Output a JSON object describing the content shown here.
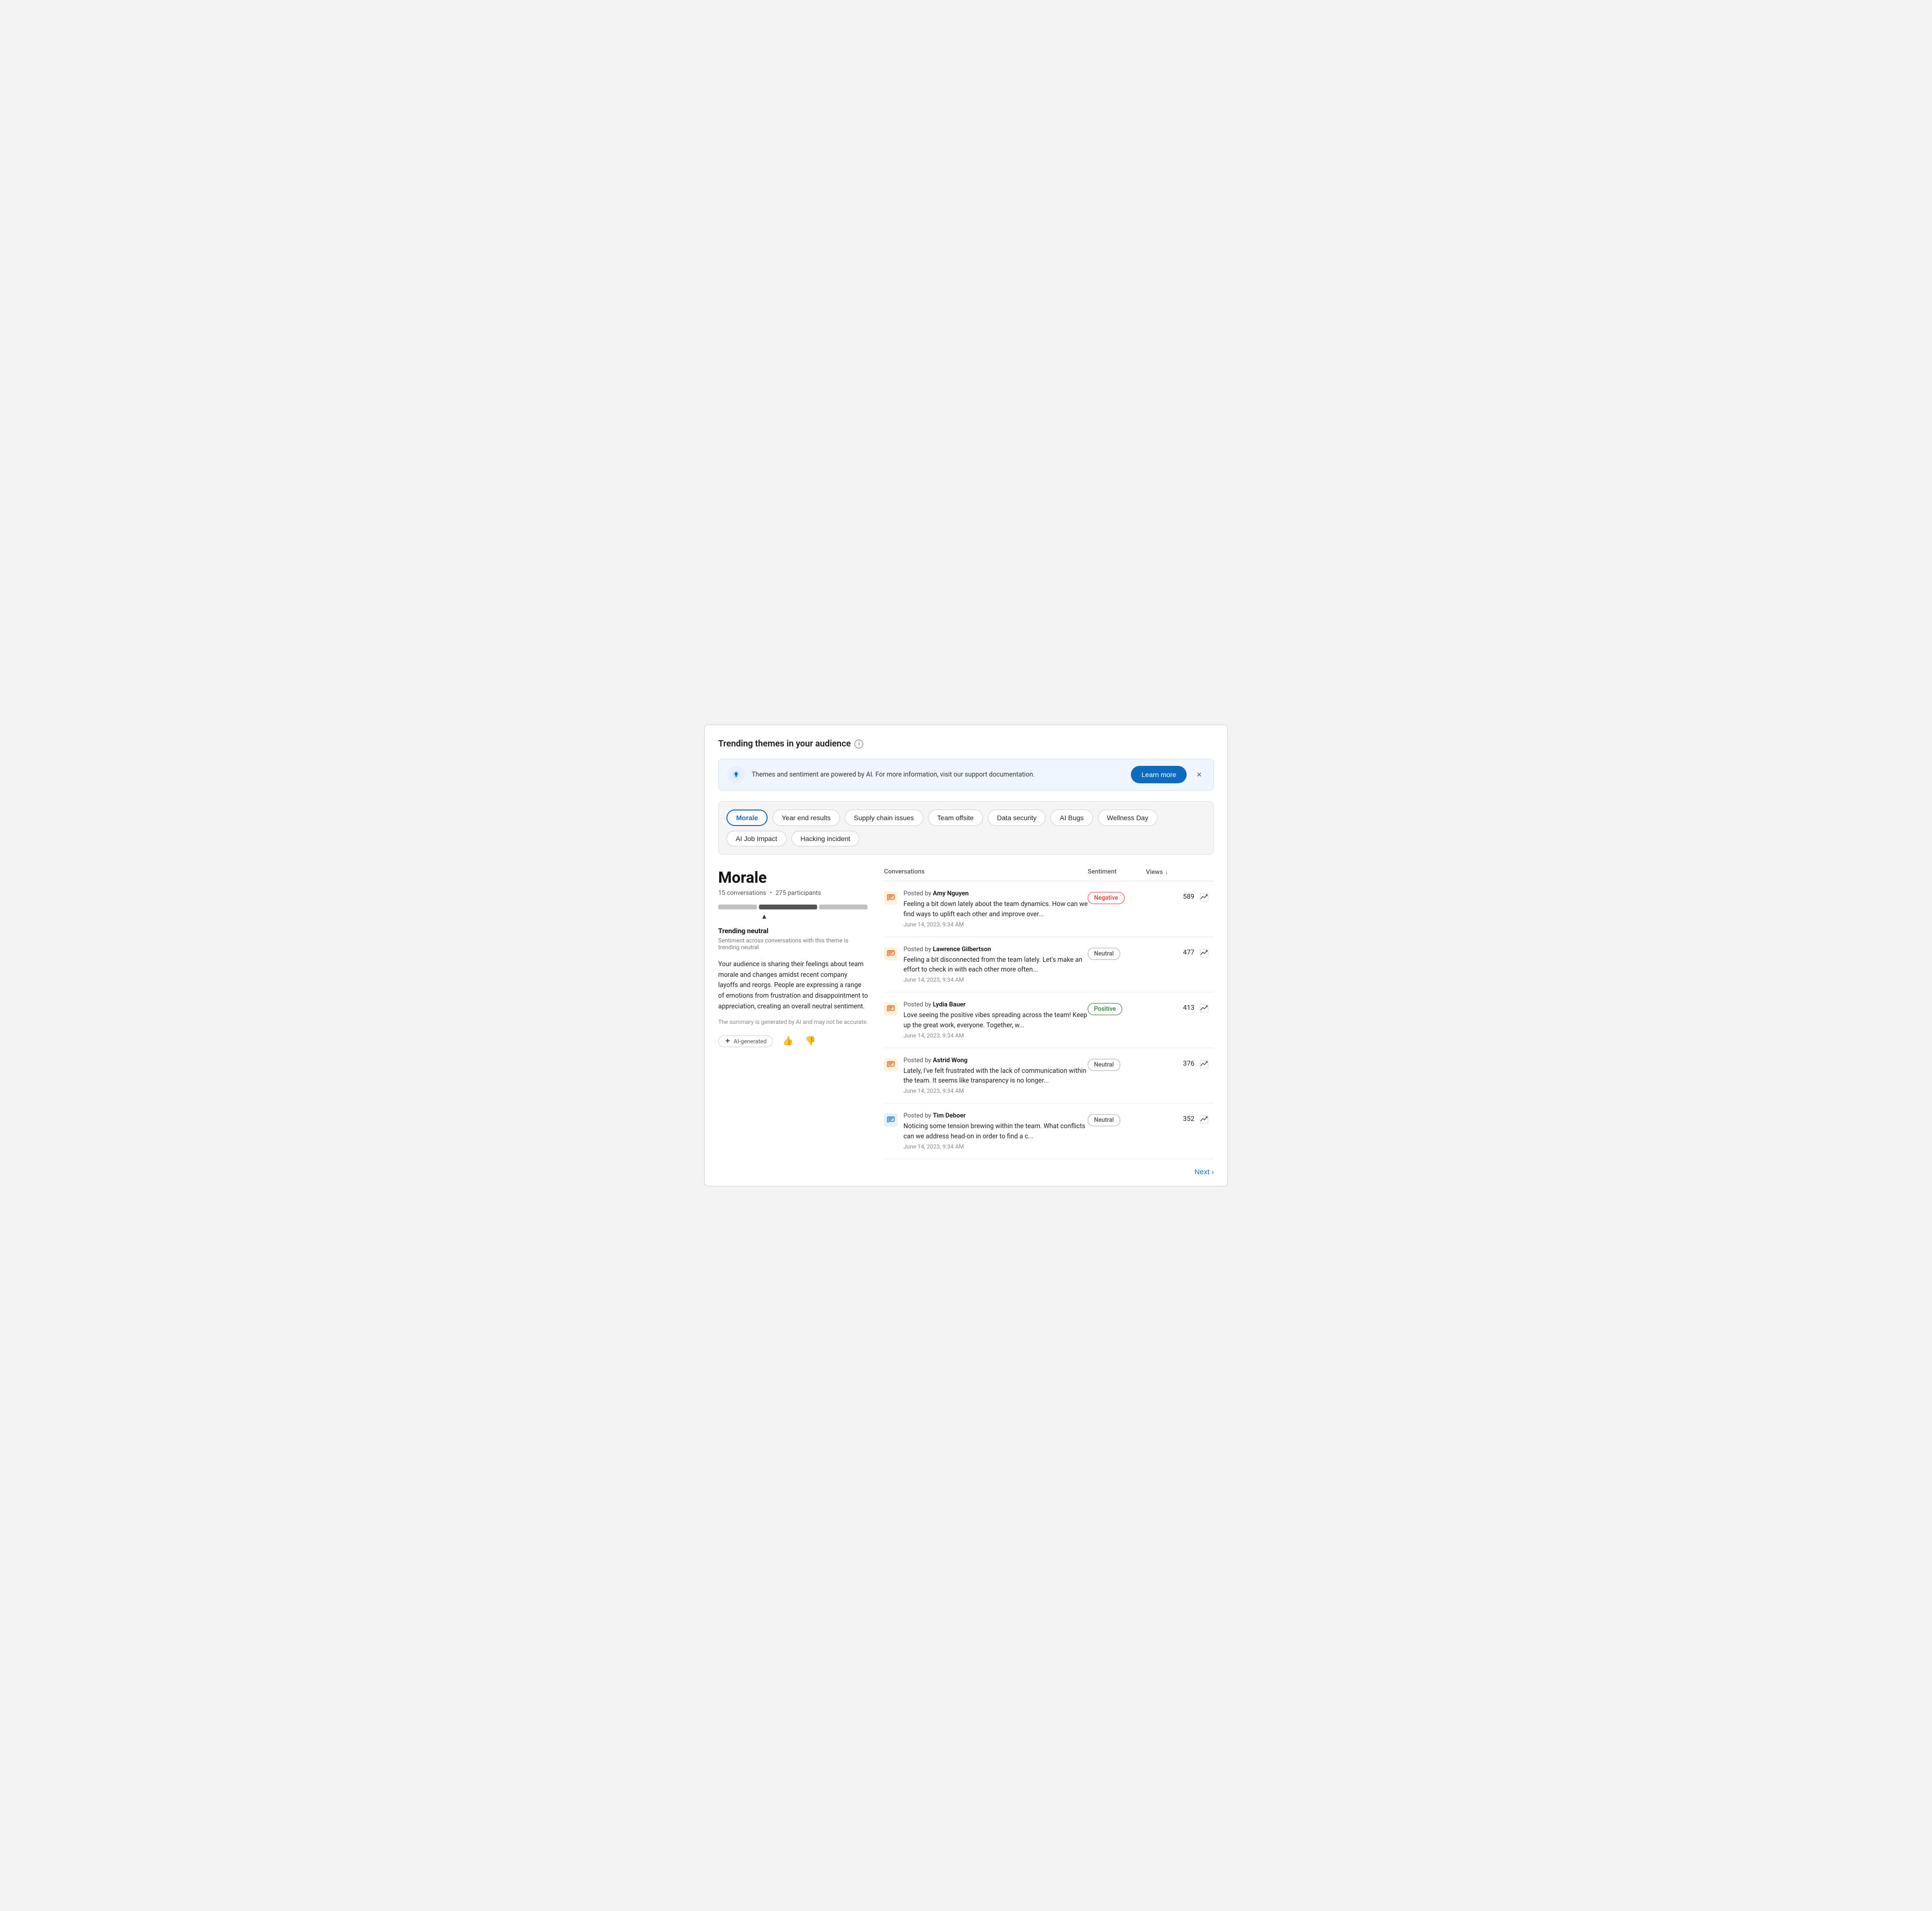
{
  "page": {
    "title": "Trending themes in your audience",
    "info_icon": "ⓘ"
  },
  "banner": {
    "text": "Themes and sentiment are powered by AI. For more information, visit our support documentation.",
    "learn_more_label": "Learn more",
    "close_label": "×"
  },
  "themes": {
    "chips": [
      {
        "id": "morale",
        "label": "Morale",
        "active": true
      },
      {
        "id": "year-end",
        "label": "Year end results",
        "active": false
      },
      {
        "id": "supply-chain",
        "label": "Supply chain issues",
        "active": false
      },
      {
        "id": "team-offsite",
        "label": "Team offsite",
        "active": false
      },
      {
        "id": "data-security",
        "label": "Data security",
        "active": false
      },
      {
        "id": "ai-bugs",
        "label": "AI Bugs",
        "active": false
      },
      {
        "id": "wellness-day",
        "label": "Wellness Day",
        "active": false
      },
      {
        "id": "ai-job-impact",
        "label": "AI Job Impact",
        "active": false
      },
      {
        "id": "hacking-incident",
        "label": "Hacking incident",
        "active": false
      }
    ]
  },
  "detail": {
    "title": "Morale",
    "conversations_count": "15 conversations",
    "participants_count": "275 participants",
    "trending_label": "Trending neutral",
    "trending_subtitle": "Sentiment across conversations with this theme is trending neutral",
    "summary": "Your audience is sharing their feelings about team morale and changes amidst recent company layoffs and reorgs. People are expressing a range of emotions from frustration and disappointment to appreciation, creating an overall neutral sentiment.",
    "ai_disclaimer": "The summary is generated by AI and may not be accurate.",
    "ai_generated_label": "AI-generated",
    "thumbs_up_label": "👍",
    "thumbs_down_label": "👎"
  },
  "table": {
    "col_conversations": "Conversations",
    "col_sentiment": "Sentiment",
    "col_views": "Views",
    "sort_icon": "↓",
    "rows": [
      {
        "id": 1,
        "poster_prefix": "Posted by",
        "poster_name": "Amy Nguyen",
        "text": "Feeling a bit down lately about the team dynamics. How can we find ways to uplift each other and improve over...",
        "date": "June 14, 2023, 9:34 AM",
        "sentiment": "Negative",
        "sentiment_type": "negative",
        "views": "589",
        "icon_type": "orange",
        "icon": "💬"
      },
      {
        "id": 2,
        "poster_prefix": "Posted by",
        "poster_name": "Lawrence Gilbertson",
        "text": "Feeling a bit disconnected from the team lately. Let's make an effort to check in with each other more often...",
        "date": "June 14, 2023, 9:34 AM",
        "sentiment": "Neutral",
        "sentiment_type": "neutral",
        "views": "477",
        "icon_type": "orange",
        "icon": "💬"
      },
      {
        "id": 3,
        "poster_prefix": "Posted by",
        "poster_name": "Lydia Bauer",
        "text": "Love seeing the positive vibes spreading across the team! Keep up the great work, everyone. Together, w...",
        "date": "June 14, 2023, 9:34 AM",
        "sentiment": "Positive",
        "sentiment_type": "positive",
        "views": "413",
        "icon_type": "orange",
        "icon": "💬"
      },
      {
        "id": 4,
        "poster_prefix": "Posted by",
        "poster_name": "Astrid Wong",
        "text": "Lately, I've felt frustrated with the lack of communication within the team. It seems like transparency is no longer...",
        "date": "June 14, 2023, 9:34 AM",
        "sentiment": "Neutral",
        "sentiment_type": "neutral",
        "views": "376",
        "icon_type": "orange",
        "icon": "💬"
      },
      {
        "id": 5,
        "poster_prefix": "Posted by",
        "poster_name": "Tim Deboer",
        "text": "Noticing some tension brewing within the team. What conflicts can we address head-on in order to find a c...",
        "date": "June 14, 2023, 9:34 AM",
        "sentiment": "Neutral",
        "sentiment_type": "neutral",
        "views": "352",
        "icon_type": "blue",
        "icon": "💬"
      }
    ]
  },
  "pagination": {
    "next_label": "Next",
    "next_icon": "›"
  }
}
